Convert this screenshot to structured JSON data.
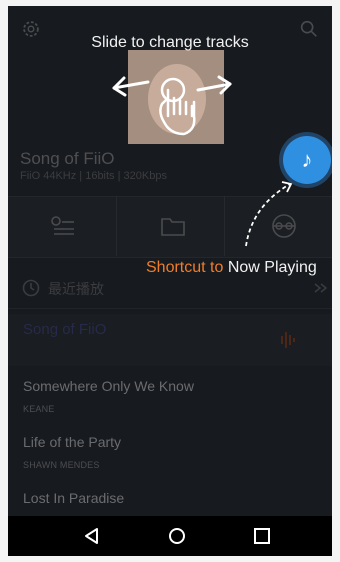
{
  "overlay": {
    "slide_hint": "Slide to change tracks",
    "shortcut_prefix": "Shortcut to ",
    "shortcut_suffix": "Now Playing",
    "accent_orange": "#ef7d29",
    "fab_icon": "music-note-icon",
    "fab_color": "#2f8fe0"
  },
  "now_playing": {
    "title": "Song of FiiO",
    "info": "FiiO 44KHz | 16bits | 320Kbps"
  },
  "tabs": [
    {
      "icon": "playlist-icon"
    },
    {
      "icon": "folder-icon"
    },
    {
      "icon": "now-playing-icon"
    }
  ],
  "recent": {
    "label": "最近播放",
    "current_track": "Song of FiiO"
  },
  "tracks": [
    {
      "title": "Somewhere Only We Know",
      "artist": "KEANE"
    },
    {
      "title": "Life of the Party",
      "artist": "SHAWN MENDES"
    },
    {
      "title": "Lost In Paradise",
      "artist": ""
    }
  ],
  "navbar": {
    "icons": [
      "back-icon",
      "home-icon",
      "recents-icon"
    ]
  }
}
